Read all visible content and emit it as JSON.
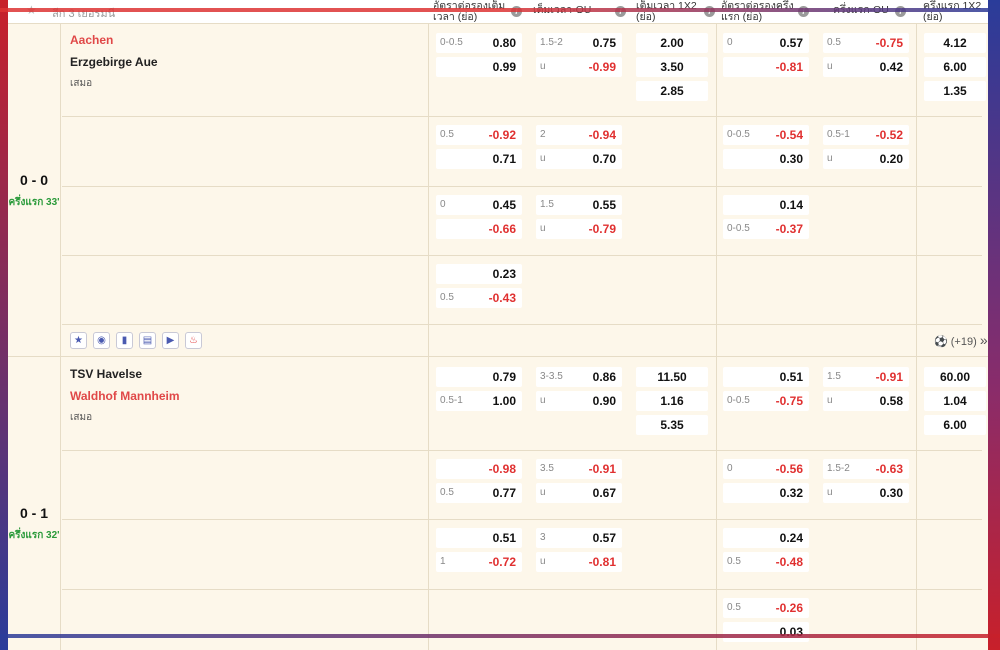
{
  "header": {
    "league": "ลีก 3 เยอรมนี",
    "col_ah_full": "อัตราต่อรองเต็มเวลา (ย่อ)",
    "col_ou_full": "เต็มเวลา-OU",
    "col_1x2_full": "เต็มเวลา 1X2 (ย่อ)",
    "col_ah_half": "อัตราต่อรองครึ่งแรก (ย่อ)",
    "col_ou_half": "ครึ่งแรก-OU",
    "col_1x2_half": "ครึ่งแรก 1X2 (ย่อ)",
    "info_icon": "i"
  },
  "matches": [
    {
      "home": "Aachen",
      "away": "Erzgebirge Aue",
      "draw_label": "เสมอ",
      "score": "0 - 0",
      "status": "ครึ่งแรก 33'",
      "rows": [
        {
          "ah_full": [
            {
              "line": "0-0.5",
              "price": "0.80"
            },
            {
              "line": "",
              "price": "0.99"
            }
          ],
          "ou_full": [
            {
              "line": "1.5-2",
              "price": "0.75"
            },
            {
              "line": "u",
              "price": "-0.99"
            }
          ],
          "x12_full": [
            "2.00",
            "3.50",
            "2.85"
          ],
          "ah_half": [
            {
              "line": "0",
              "price": "0.57"
            },
            {
              "line": "",
              "price": "-0.81"
            }
          ],
          "ou_half": [
            {
              "line": "0.5",
              "price": "-0.75"
            },
            {
              "line": "u",
              "price": "0.42"
            }
          ],
          "x12_half": [
            "4.12",
            "6.00",
            "1.35"
          ]
        },
        {
          "ah_full": [
            {
              "line": "0.5",
              "price": "-0.92"
            },
            {
              "line": "",
              "price": "0.71"
            }
          ],
          "ou_full": [
            {
              "line": "2",
              "price": "-0.94"
            },
            {
              "line": "u",
              "price": "0.70"
            }
          ],
          "ah_half": [
            {
              "line": "0-0.5",
              "price": "-0.54"
            },
            {
              "line": "",
              "price": "0.30"
            }
          ],
          "ou_half": [
            {
              "line": "0.5-1",
              "price": "-0.52"
            },
            {
              "line": "u",
              "price": "0.20"
            }
          ]
        },
        {
          "ah_full": [
            {
              "line": "0",
              "price": "0.45"
            },
            {
              "line": "",
              "price": "-0.66"
            }
          ],
          "ou_full": [
            {
              "line": "1.5",
              "price": "0.55"
            },
            {
              "line": "u",
              "price": "-0.79"
            }
          ],
          "ah_half": [
            {
              "line": "",
              "price": "0.14"
            },
            {
              "line": "0-0.5",
              "price": "-0.37"
            }
          ]
        },
        {
          "ah_full": [
            {
              "line": "",
              "price": "0.23"
            },
            {
              "line": "0.5",
              "price": "-0.43"
            }
          ]
        }
      ],
      "more_label": "(+19)"
    },
    {
      "home": "TSV Havelse",
      "away": "Waldhof Mannheim",
      "draw_label": "เสมอ",
      "score": "0 - 1",
      "status": "ครึ่งแรก 32'",
      "rows": [
        {
          "ah_full": [
            {
              "line": "",
              "price": "0.79"
            },
            {
              "line": "0.5-1",
              "price": "1.00"
            }
          ],
          "ou_full": [
            {
              "line": "3-3.5",
              "price": "0.86"
            },
            {
              "line": "u",
              "price": "0.90"
            }
          ],
          "x12_full": [
            "11.50",
            "1.16",
            "5.35"
          ],
          "ah_half": [
            {
              "line": "",
              "price": "0.51"
            },
            {
              "line": "0-0.5",
              "price": "-0.75"
            }
          ],
          "ou_half": [
            {
              "line": "1.5",
              "price": "-0.91"
            },
            {
              "line": "u",
              "price": "0.58"
            }
          ],
          "x12_half": [
            "60.00",
            "1.04",
            "6.00"
          ]
        },
        {
          "ah_full": [
            {
              "line": "",
              "price": "-0.98"
            },
            {
              "line": "0.5",
              "price": "0.77"
            }
          ],
          "ou_full": [
            {
              "line": "3.5",
              "price": "-0.91"
            },
            {
              "line": "u",
              "price": "0.67"
            }
          ],
          "ah_half": [
            {
              "line": "0",
              "price": "-0.56"
            },
            {
              "line": "",
              "price": "0.32"
            }
          ],
          "ou_half": [
            {
              "line": "1.5-2",
              "price": "-0.63"
            },
            {
              "line": "u",
              "price": "0.30"
            }
          ]
        },
        {
          "ah_full": [
            {
              "line": "",
              "price": "0.51"
            },
            {
              "line": "1",
              "price": "-0.72"
            }
          ],
          "ou_full": [
            {
              "line": "3",
              "price": "0.57"
            },
            {
              "line": "u",
              "price": "-0.81"
            }
          ],
          "ah_half": [
            {
              "line": "",
              "price": "0.24"
            },
            {
              "line": "0.5",
              "price": "-0.48"
            }
          ]
        },
        {
          "ah_half": [
            {
              "line": "0.5",
              "price": "-0.26"
            },
            {
              "line": "",
              "price": "0.03"
            }
          ]
        }
      ]
    }
  ],
  "toolbar_icons": [
    "star-icon",
    "eye-icon",
    "stats-icon",
    "lineup-icon",
    "play-icon",
    "fire-icon"
  ],
  "colors": {
    "negative": "#e03030",
    "home_team": "#e04848",
    "live": "#2a9a3a",
    "row_bg": "#fdf7ea"
  }
}
